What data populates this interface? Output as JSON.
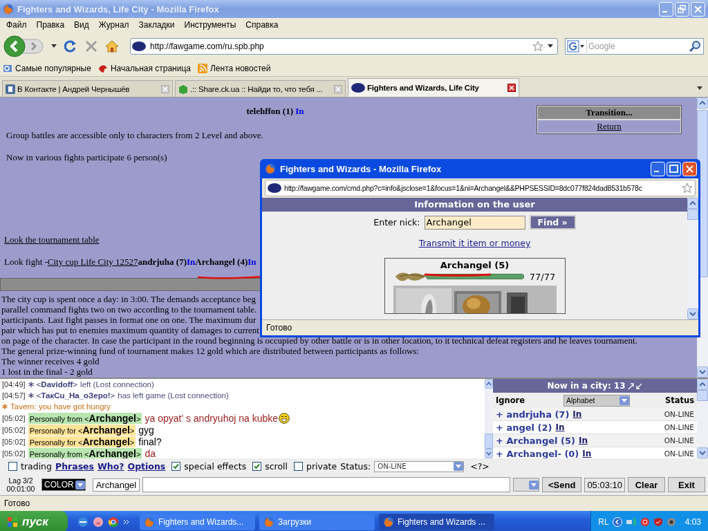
{
  "window": {
    "title": "Fighters and Wizards, Life City - Mozilla Firefox"
  },
  "menu": [
    "Файл",
    "Правка",
    "Вид",
    "Журнал",
    "Закладки",
    "Инструменты",
    "Справка"
  ],
  "address_bar": {
    "url": "http://fawgame.com/ru.spb.php"
  },
  "search": {
    "placeholder": "Google"
  },
  "bookmarks": [
    "Самые популярные",
    "Начальная страница",
    "Лента новостей"
  ],
  "tabs": [
    {
      "label": "В Контакте | Андрей Чернышёв",
      "selected": false
    },
    {
      "label": ".:: Share.ck.ua :: Найди то, что тебя ...",
      "selected": false
    },
    {
      "label": "Fighters and Wizards, Life City",
      "selected": true
    }
  ],
  "page": {
    "player": {
      "name": "telehffon (1)",
      "link": "In"
    },
    "transition": {
      "title": "Transition...",
      "link": "Return"
    },
    "notes": [
      "Group battles are accessible only to characters from 2 Level and above.",
      "Now in various fights participate 6 person(s)"
    ],
    "table_link": "Look the tournament table",
    "fight": {
      "label": "Look fight -",
      "link": "City cup Life City 12527",
      "fighters": [
        {
          "name": "andrjuha (7)",
          "link": "In"
        },
        {
          "name": "Archangel (4)",
          "link": "In"
        }
      ]
    },
    "rules": [
      "The city cup is spent once a day: in 3:00. The demands acceptance beg",
      "parallel command fights two on two according to the tournament table.",
      "participants. Last fight passes in format one on one. The maximum dur",
      "pair which has put to enemies maximum quantity of damages to current",
      "on page of the character. In case the participant in the round beginning is occupied by other battle or is in other location, to it technical defeat registers and he leaves tournament.",
      "The general prize-winning fund of tournament makes 12 gold which are distributed between participants as follows:",
      "The winner receives 4 gold",
      "1 lost in the final - 2 gold"
    ]
  },
  "popup": {
    "title": "Fighters and Wizards - Mozilla Firefox",
    "url": "http://fawgame.com/cmd.php?c=info&jsclose=1&focus=1&ni=Archangel&&PHPSESSID=8dc077f824dad8531b578c",
    "header": "Information on the user",
    "nick_label": "Enter nick:",
    "nick_value": "Archangel",
    "find": "Find »",
    "link": "Transmit it item or money",
    "card": {
      "name": "Archangel (5)",
      "health": {
        "level": 1.0,
        "reading": "77/77"
      }
    },
    "status": "Готово"
  },
  "chat": {
    "messages": [
      {
        "kind": "system",
        "time": "[04:49]",
        "nick": "<**Davidoff**>",
        "text": "left (Lost connection)"
      },
      {
        "kind": "system",
        "time": "[04:57]",
        "nick": "<**ТакСu_На_оЗеро!**>",
        "text": "has left game (Lost connection)"
      },
      {
        "kind": "notice",
        "text": "Tavern: you have got hungry"
      },
      {
        "kind": "from",
        "time": "[05:02]",
        "badge": "Personally from <**Archangel**>",
        "text": "ya opyat' s andryuhoj na kubke",
        "smiley": true
      },
      {
        "kind": "for",
        "time": "[05:02]",
        "badge": "Personally for <**Archangel**>",
        "text": "gyg",
        "smiley": false
      },
      {
        "kind": "for",
        "time": "[05:02]",
        "badge": "Personally for <**Archangel**>",
        "text": "final?",
        "smiley": false
      },
      {
        "kind": "from",
        "time": "[05:02]",
        "badge": "Personally from <**Archangel**>",
        "text": "da",
        "smiley": false
      }
    ]
  },
  "city_panel": {
    "title": "Now in a city: 13",
    "ignore": "Ignore",
    "sort": "Alphabet",
    "status": "Status",
    "users": [
      {
        "name": "+ andrjuha (7)",
        "link": "In",
        "status": "ON-LINE"
      },
      {
        "name": "+ angel (2)",
        "link": "In",
        "status": "ON-LINE"
      },
      {
        "name": "+ Archangel (5)",
        "link": "In",
        "status": "ON-LINE"
      },
      {
        "name": "+ Archangel- (0)",
        "link": "In",
        "status": "ON-LINE"
      }
    ]
  },
  "options": [
    {
      "kind": "checkbox",
      "label": "trading",
      "checked": false
    },
    {
      "kind": "link",
      "label": "Phrases"
    },
    {
      "kind": "link",
      "label": "Who?"
    },
    {
      "kind": "link",
      "label": "Options"
    },
    {
      "kind": "checkbox",
      "label": "special effects",
      "checked": true
    },
    {
      "kind": "checkbox",
      "label": "scroll",
      "checked": true
    },
    {
      "kind": "checkbox",
      "label": "private",
      "checked": false
    },
    {
      "kind": "select",
      "label": "Status:",
      "value": "ON-LINE"
    },
    {
      "kind": "help",
      "label": "<?>"
    }
  ],
  "input_bar": {
    "lag": "Lag 3/2",
    "timer": "00:01:00",
    "color_label": "COLOR",
    "nick": "Archangel",
    "send": "<Send",
    "clock": "05:03:10",
    "buttons": [
      "Clear",
      "Exit"
    ]
  },
  "status_bar": "Готово",
  "taskbar": {
    "start": "пуск",
    "tasks": [
      {
        "label": "Fighters and Wizards...",
        "selected": false
      },
      {
        "label": "Загрузки",
        "selected": false
      },
      {
        "label": "Fighters and Wizards ...",
        "selected": true
      }
    ],
    "tray_label": "RL",
    "clock": "4:03"
  }
}
